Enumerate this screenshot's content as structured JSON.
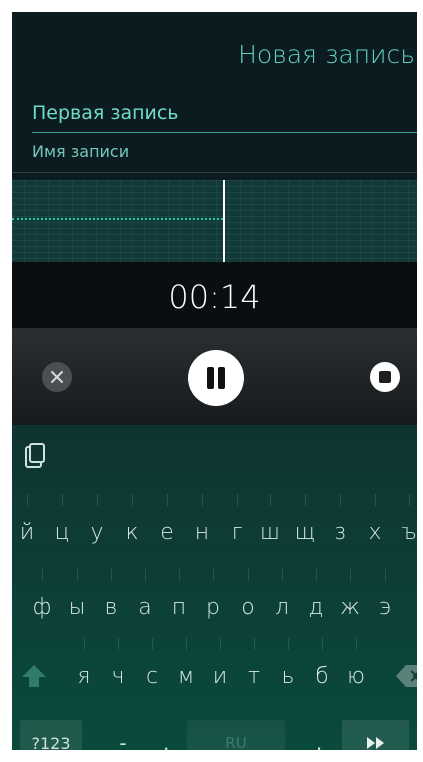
{
  "header": {
    "title": "Новая запись",
    "name_value": "Первая запись",
    "name_label": "Имя записи"
  },
  "recorder": {
    "timer": "00:14"
  },
  "controls": {
    "cancel_icon": "close-icon",
    "pause_icon": "pause-icon",
    "stop_icon": "stop-icon"
  },
  "keyboard": {
    "clipboard_icon": "clipboard-icon",
    "row1": [
      "й",
      "ц",
      "у",
      "к",
      "е",
      "н",
      "г",
      "ш",
      "щ",
      "з",
      "х",
      "ъ"
    ],
    "row2": [
      "ф",
      "ы",
      "в",
      "а",
      "п",
      "р",
      "о",
      "л",
      "д",
      "ж",
      "э"
    ],
    "row3": [
      "я",
      "ч",
      "с",
      "м",
      "и",
      "т",
      "ь",
      "б",
      "ю"
    ],
    "symbols_label": "?123",
    "dash": "-",
    "comma": ",",
    "space_label": "RU",
    "period": ".",
    "enter_icon": "fast-forward-icon",
    "accent": "#2ecfa8"
  }
}
